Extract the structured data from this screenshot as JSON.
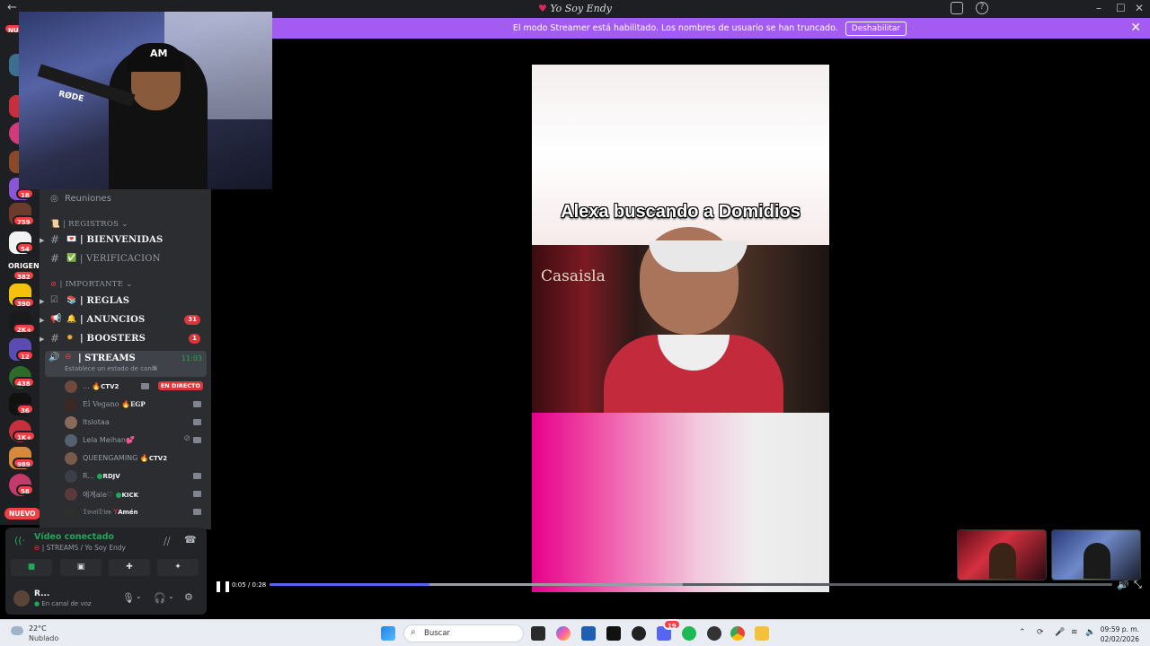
{
  "window": {
    "title": "Yo Soy Endy",
    "back": "←"
  },
  "banner": {
    "message": "El modo Streamer está habilitado. Los nombres de usuario se han truncado.",
    "button": "Deshabilitar",
    "close": "✕"
  },
  "rail": {
    "badges": [
      "18",
      "759",
      "54",
      "382",
      "390",
      "2K+",
      "12",
      "438",
      "36",
      "1K+",
      "989",
      "58"
    ],
    "top_badge": "NU",
    "origin_label": "ORIGEN",
    "nuevo": "NUEVO"
  },
  "webcam": {
    "cap_logo": "AM",
    "mic_brand": "RØDE"
  },
  "sidebar": {
    "reuniones": "Reuniones",
    "cat_registros": "| REGISTROS",
    "bienvenidas": "| BIENVENIDAS",
    "verificacion": "| VERIFICACION",
    "cat_importante": "| IMPORTANTE",
    "reglas": "| REGLAS",
    "anuncios": "| ANUNCIOS",
    "anuncios_count": "31",
    "boosters": "| BOOSTERS",
    "boosters_count": "1",
    "streams": "| STREAMS",
    "streams_time": "11:03",
    "streams_status": "Establece un estado de canal",
    "live_label": "EN DIRECTO",
    "users": [
      {
        "name": "...",
        "tag": "CTV2"
      },
      {
        "name": "El Vegano",
        "tag": "EGP"
      },
      {
        "name": "Itslotaa",
        "tag": ""
      },
      {
        "name": "Lela Meihan",
        "tag": ""
      },
      {
        "name": "QUEENGAMING",
        "tag": "CTV2"
      },
      {
        "name": "R...",
        "tag": "RDJV"
      },
      {
        "name": "에게ale♡",
        "tag": "KICK"
      },
      {
        "name": "𝔇𝔬𝔪𝔦𝔇𝔦𝔬𝔰",
        "tag": "Amén"
      }
    ]
  },
  "voice": {
    "status": "Vídeo conectado",
    "channel": "| STREAMS / Yo Soy Endy",
    "user_name": "R...",
    "user_status": "En canal de voz"
  },
  "video": {
    "caption": "Alexa buscando a Domidios",
    "sign": "Casaisla",
    "time": "0:05 / 0:28",
    "progress": 0.19,
    "buffered": 0.49
  },
  "taskbar": {
    "temp": "22°C",
    "weather": "Nublado",
    "search_placeholder": "Buscar",
    "discord_badge": "19",
    "time": "09:59 p. m.",
    "date": "02/02/2026"
  },
  "colors": {
    "banner": "#a45bf1",
    "accent": "#5865f2",
    "live": "#da373c",
    "connected": "#23a55a"
  }
}
